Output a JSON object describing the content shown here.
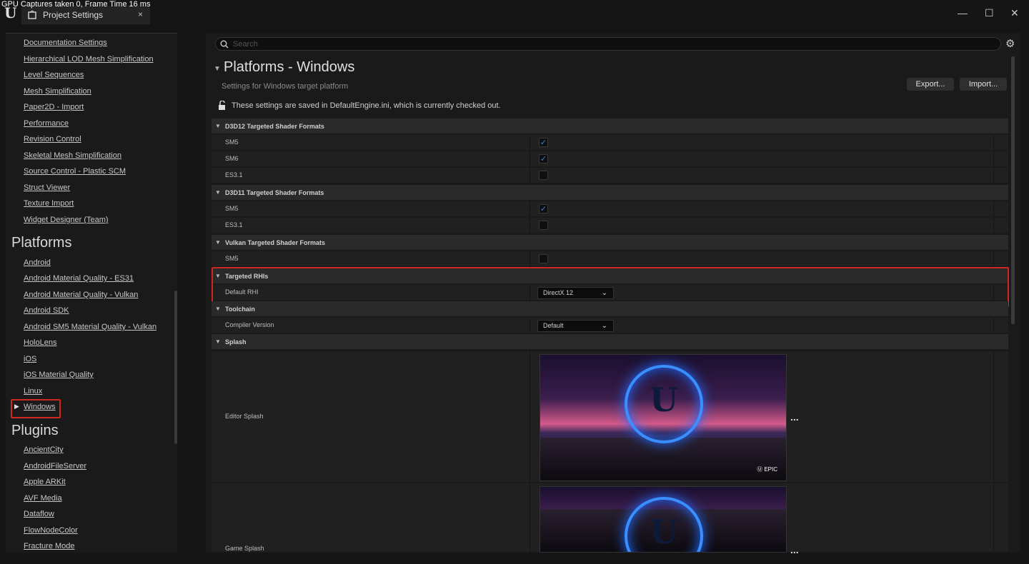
{
  "overlay_text": "GPU Captures taken 0, Frame Time 16 ms",
  "window": {
    "tab_title": "Project Settings",
    "close_tab": "×",
    "minimize": "—",
    "maximize": "☐",
    "close": "✕"
  },
  "sidebar": {
    "items_top": [
      "Documentation Settings",
      "Hierarchical LOD Mesh Simplification",
      "Level Sequences",
      "Mesh Simplification",
      "Paper2D - Import",
      "Performance",
      "Revision Control",
      "Skeletal Mesh Simplification",
      "Source Control - Plastic SCM",
      "Struct Viewer",
      "Texture Import",
      "Widget Designer (Team)"
    ],
    "platforms_header": "Platforms",
    "platforms": [
      "Android",
      "Android Material Quality - ES31",
      "Android Material Quality - Vulkan",
      "Android SDK",
      "Android SM5 Material Quality - Vulkan",
      "HoloLens",
      "iOS",
      "iOS Material Quality",
      "Linux",
      "Windows"
    ],
    "plugins_header": "Plugins",
    "plugins": [
      "AncientCity",
      "AndroidFileServer",
      "Apple ARKit",
      "AVF Media",
      "Dataflow",
      "FlowNodeColor",
      "Fracture Mode"
    ]
  },
  "main": {
    "search_placeholder": "Search",
    "title": "Platforms - Windows",
    "subtitle": "Settings for Windows target platform",
    "export_label": "Export...",
    "import_label": "Import...",
    "notice": "These settings are saved in DefaultEngine.ini, which is currently checked out.",
    "sections": {
      "d3d12": "D3D12 Targeted Shader Formats",
      "d3d11": "D3D11 Targeted Shader Formats",
      "vulkan": "Vulkan Targeted Shader Formats",
      "rhi": "Targeted RHIs",
      "toolchain": "Toolchain",
      "splash": "Splash"
    },
    "rows": {
      "d3d12_sm5": {
        "label": "SM5",
        "checked": true
      },
      "d3d12_sm6": {
        "label": "SM6",
        "checked": true
      },
      "d3d12_es31": {
        "label": "ES3.1",
        "checked": false
      },
      "d3d11_sm5": {
        "label": "SM5",
        "checked": true
      },
      "d3d11_es31": {
        "label": "ES3.1",
        "checked": false
      },
      "vulkan_sm5": {
        "label": "SM5",
        "checked": false
      },
      "default_rhi": {
        "label": "Default RHI",
        "value": "DirectX 12"
      },
      "compiler": {
        "label": "Compiler Version",
        "value": "Default"
      },
      "editor_splash": {
        "label": "Editor Splash"
      },
      "game_splash": {
        "label": "Game Splash"
      }
    },
    "check_glyph": "✓",
    "ellipsis": "..."
  },
  "colors": {
    "highlight": "#d0281e",
    "check": "#3b82d6"
  }
}
